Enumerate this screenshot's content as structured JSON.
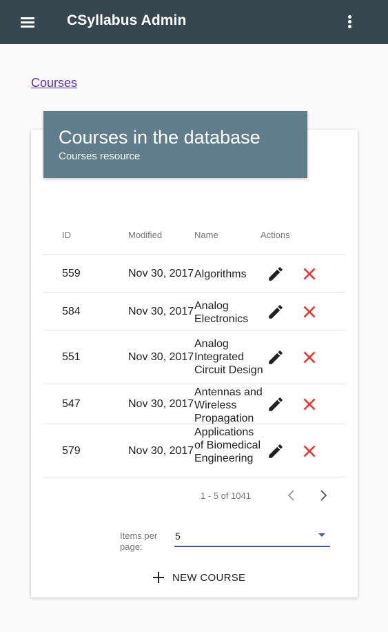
{
  "appbar": {
    "title": "CSyllabus Admin",
    "menu_icon": "menu-icon",
    "more_icon": "more-vert-icon"
  },
  "breadcrumb": {
    "label": "Courses"
  },
  "card": {
    "title": "Courses in the database",
    "subtitle": "Courses resource"
  },
  "table": {
    "columns": [
      "ID",
      "Modified",
      "Name",
      "Actions"
    ],
    "rows": [
      {
        "id": "559",
        "modified": "Nov 30, 2017",
        "name": "Algorithms"
      },
      {
        "id": "584",
        "modified": "Nov 30, 2017",
        "name": "Analog Electronics"
      },
      {
        "id": "551",
        "modified": "Nov 30, 2017",
        "name": "Analog Integrated Circuit Design"
      },
      {
        "id": "547",
        "modified": "Nov 30, 2017",
        "name": "Antennas and Wireless Propagation"
      },
      {
        "id": "579",
        "modified": "Nov 30, 2017",
        "name": "Applications of Biomedical Engineering"
      }
    ]
  },
  "pagination": {
    "range": "1 - 5 of 1041",
    "items_per_page_label": "Items per page:",
    "items_per_page": "5"
  },
  "actions": {
    "new_course_label": "NEW COURSE"
  },
  "colors": {
    "appbar": "#37474f",
    "card_header": "#607d8b",
    "delete": "#e53935",
    "accent": "#3f51b5",
    "link": "#5e2ca5"
  }
}
